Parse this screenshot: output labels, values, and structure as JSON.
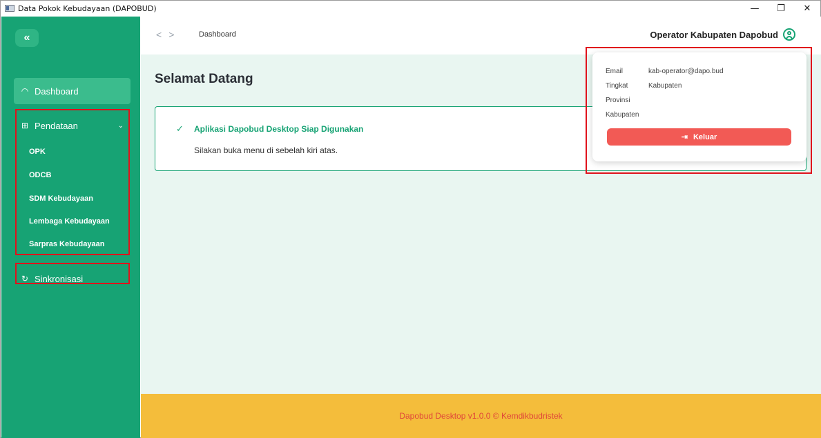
{
  "window": {
    "title": "Data Pokok Kebudayaan (DAPOBUD)",
    "controls": {
      "minimize": "—",
      "maximize": "❐",
      "close": "✕"
    }
  },
  "sidebar": {
    "collapse_icon": "«",
    "dashboard_label": "Dashboard",
    "dashboard_icon": "◠",
    "pendataan_label": "Pendataan",
    "pendataan_icon": "⊞",
    "pendataan_chevron": "⌄",
    "sub_items": [
      "OPK",
      "ODCB",
      "SDM Kebudayaan",
      "Lembaga Kebudayaan",
      "Sarpras Kebudayaan"
    ],
    "sync_label": "Sinkronisasi",
    "sync_icon": "↻"
  },
  "header": {
    "back_icon": "<",
    "forward_icon": ">",
    "breadcrumb": "Dashboard",
    "user_name": "Operator Kabupaten Dapobud"
  },
  "main": {
    "heading": "Selamat Datang",
    "card_check": "✓",
    "card_title": "Aplikasi Dapobud Desktop Siap Digunakan",
    "card_text": "Silakan buka menu di sebelah kiri atas."
  },
  "profile_popup": {
    "email_label": "Email",
    "email_value": "kab-operator@dapo.bud",
    "tingkat_label": "Tingkat",
    "tingkat_value": "Kabupaten",
    "provinsi_label": "Provinsi",
    "provinsi_value": "",
    "kabupaten_label": "Kabupaten",
    "kabupaten_value": "",
    "logout_icon": "⇥",
    "logout_label": "Keluar"
  },
  "footer": {
    "text": "Dapobud Desktop v1.0.0 © Kemdikbudristek"
  },
  "colors": {
    "sidebar": "#17a374",
    "footer": "#f4bd3b",
    "accent": "#17a374",
    "logout": "#f25a55",
    "highlight": "#e0121b"
  }
}
